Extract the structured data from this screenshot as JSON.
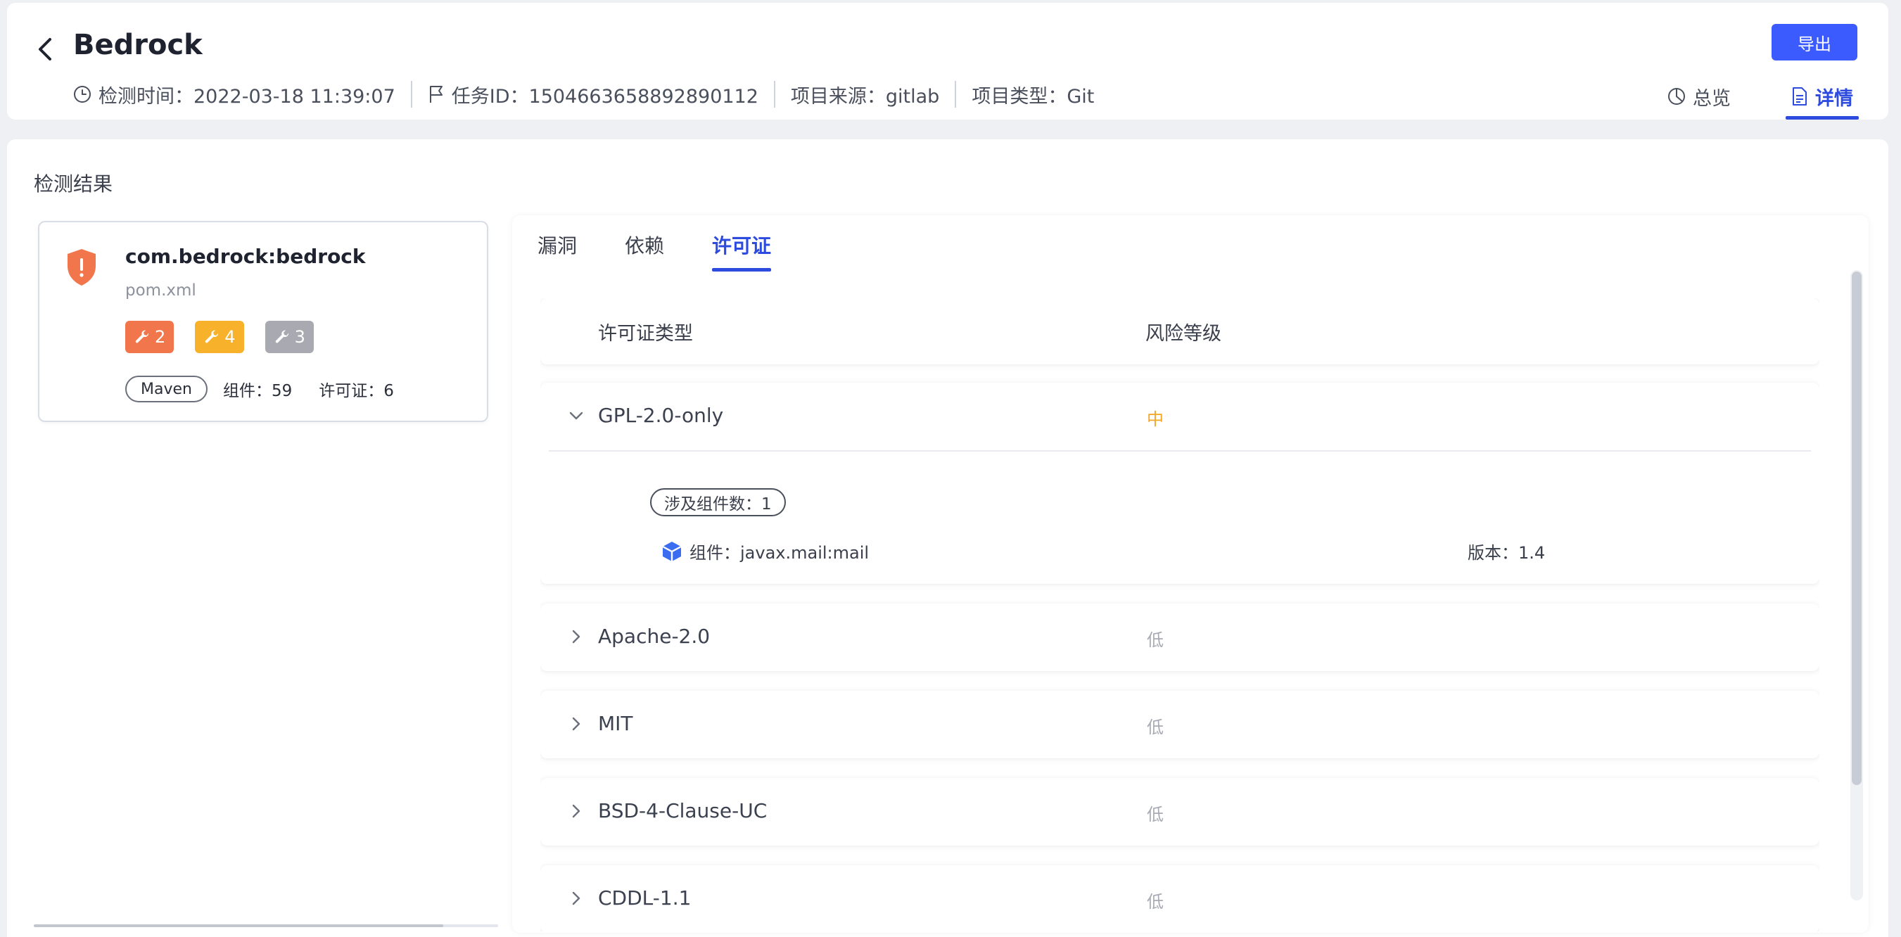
{
  "header": {
    "title": "Bedrock",
    "meta": [
      {
        "icon": "clock-icon",
        "text": "检测时间：2022-03-18 11:39:07"
      },
      {
        "icon": "flag-icon",
        "text": "任务ID：1504663658892890112"
      },
      {
        "icon": "",
        "text": "项目来源：gitlab"
      },
      {
        "icon": "",
        "text": "项目类型：Git"
      }
    ],
    "export_label": "导出",
    "tabs": [
      {
        "icon": "pie-chart-icon",
        "label": "总览",
        "active": false
      },
      {
        "icon": "document-icon",
        "label": "详情",
        "active": true
      }
    ]
  },
  "main": {
    "section_title": "检测结果",
    "project": {
      "name": "com.bedrock:bedrock",
      "file": "pom.xml",
      "badges": [
        {
          "level": "high",
          "count": "2",
          "color": "#f2764c"
        },
        {
          "level": "mid",
          "count": "4",
          "color": "#f7b12a"
        },
        {
          "level": "low",
          "count": "3",
          "color": "#a9aab1"
        }
      ],
      "package_type": "Maven",
      "components": "组件：59",
      "licenses": "许可证：6"
    },
    "detail_tabs": [
      {
        "label": "漏洞",
        "active": false
      },
      {
        "label": "依赖",
        "active": false
      },
      {
        "label": "许可证",
        "active": true
      }
    ],
    "table": {
      "columns": [
        "许可证类型",
        "风险等级"
      ],
      "rows": [
        {
          "name": "GPL-2.0-only",
          "risk": "中",
          "risk_level": "mid",
          "expanded": true,
          "component_count": "涉及组件数：1",
          "component": "组件：javax.mail:mail",
          "version": "版本：1.4"
        },
        {
          "name": "Apache-2.0",
          "risk": "低",
          "risk_level": "low",
          "expanded": false
        },
        {
          "name": "MIT",
          "risk": "低",
          "risk_level": "low",
          "expanded": false
        },
        {
          "name": "BSD-4-Clause-UC",
          "risk": "低",
          "risk_level": "low",
          "expanded": false
        },
        {
          "name": "CDDL-1.1",
          "risk": "低",
          "risk_level": "low",
          "expanded": false
        }
      ]
    }
  },
  "colors": {
    "accent": "#2d4cdf",
    "button": "#3b5bff",
    "risk_mid": "#f5a623",
    "risk_low": "#a8abb3",
    "shield": "#f2764c"
  }
}
